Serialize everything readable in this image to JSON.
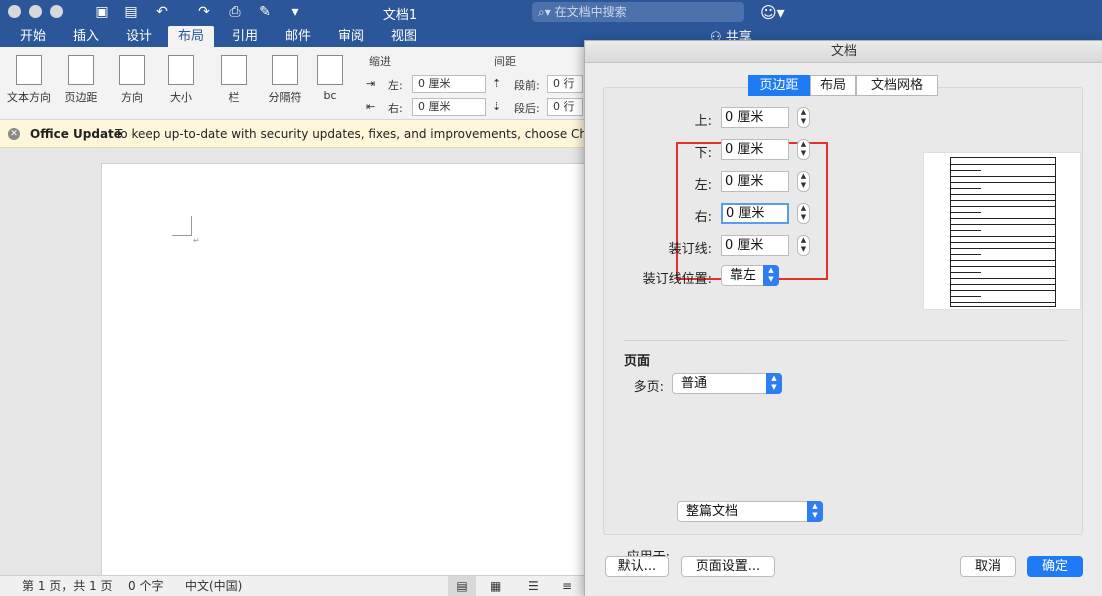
{
  "titlebar": {
    "doc_title": "文档1",
    "search_placeholder": "在文档中搜索"
  },
  "tabs": [
    "开始",
    "插入",
    "设计",
    "布局",
    "引用",
    "邮件",
    "审阅",
    "视图"
  ],
  "active_tab": "布局",
  "share_label": "共享",
  "ribbon": {
    "text_direction": "文本方向",
    "margins": "页边距",
    "orientation": "方向",
    "size": "大小",
    "columns": "栏",
    "breaks": "分隔符",
    "hyphenation": "bc",
    "indent_section": "缩进",
    "spacing_section": "间距",
    "indent_left_label": "左:",
    "indent_left_value": "0 厘米",
    "indent_right_label": "右:",
    "indent_right_value": "0 厘米",
    "spacing_before_label": "段前:",
    "spacing_before_value": "0 行",
    "spacing_after_label": "段后:",
    "spacing_after_value": "0 行"
  },
  "update_bar": {
    "title": "Office Update",
    "message": "To keep up-to-date with security updates, fixes, and improvements, choose Check for U"
  },
  "statusbar": {
    "page_info": "第 1 页，共 1 页",
    "word_count": "0 个字",
    "language": "中文(中国)"
  },
  "dialog": {
    "title": "文档",
    "tabs": [
      "页边距",
      "布局",
      "文档网格"
    ],
    "active_tab": "页边距",
    "top_label": "上:",
    "top_value": "0 厘米",
    "bottom_label": "下:",
    "bottom_value": "0 厘米",
    "left_label": "左:",
    "left_value": "0 厘米",
    "right_label": "右:",
    "right_value": "0 厘米",
    "gutter_label": "装订线:",
    "gutter_value": "0 厘米",
    "gutter_pos_label": "装订线位置:",
    "gutter_pos_value": "靠左",
    "pages_section": "页面",
    "multiple_pages_label": "多页:",
    "multiple_pages_value": "普通",
    "apply_to_label": "应用于:",
    "apply_to_value": "整篇文档",
    "default_button": "默认...",
    "page_setup_button": "页面设置...",
    "cancel_button": "取消",
    "ok_button": "确定"
  },
  "colors": {
    "ribbon_blue": "#2b579a",
    "accent": "#1f7bf5",
    "highlight_red": "#e0312f"
  }
}
